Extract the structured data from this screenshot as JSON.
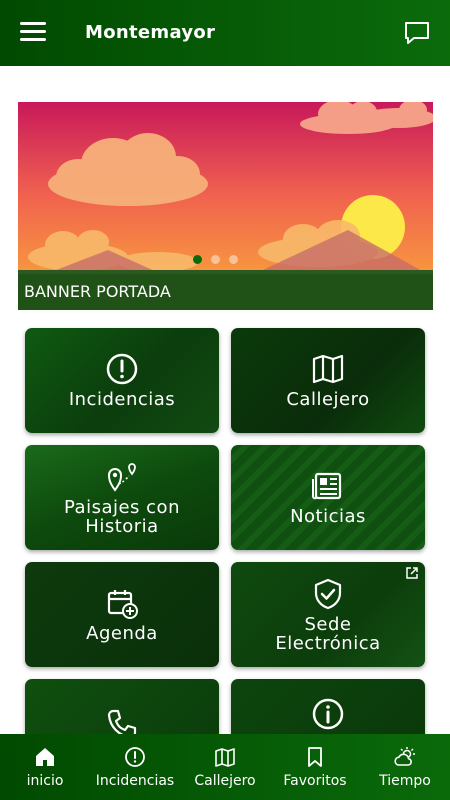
{
  "header": {
    "title": "Montemayor",
    "menu_icon": "hamburger-menu-icon",
    "chat_icon": "message-bubble-icon"
  },
  "banner": {
    "caption": "BANNER PORTADA",
    "slide_count": 3,
    "active_slide": 1
  },
  "tiles": [
    {
      "label": "Incidencias",
      "icon": "alert-circle-icon"
    },
    {
      "label": "Callejero",
      "icon": "map-icon"
    },
    {
      "label": "Paisajes con Historia",
      "icon": "route-pin-icon"
    },
    {
      "label": "Noticias",
      "icon": "newspaper-icon"
    },
    {
      "label": "Agenda",
      "icon": "calendar-add-icon"
    },
    {
      "label": "Sede Electrónica",
      "icon": "shield-check-icon",
      "external_icon": "external-link-icon"
    },
    {
      "label": "",
      "icon": "phone-icon"
    },
    {
      "label": "",
      "icon": "info-circle-icon"
    }
  ],
  "bottom_nav": [
    {
      "label": "inicio",
      "icon": "home-icon"
    },
    {
      "label": "Incidencias",
      "icon": "alert-circle-icon"
    },
    {
      "label": "Callejero",
      "icon": "map-icon"
    },
    {
      "label": "Favoritos",
      "icon": "bookmark-icon"
    },
    {
      "label": "Tiempo",
      "icon": "weather-sun-cloud-icon"
    }
  ],
  "colors": {
    "primary": "#0b6b0b",
    "primary_dark": "#014a01",
    "dot_active": "#0a6b0a"
  }
}
